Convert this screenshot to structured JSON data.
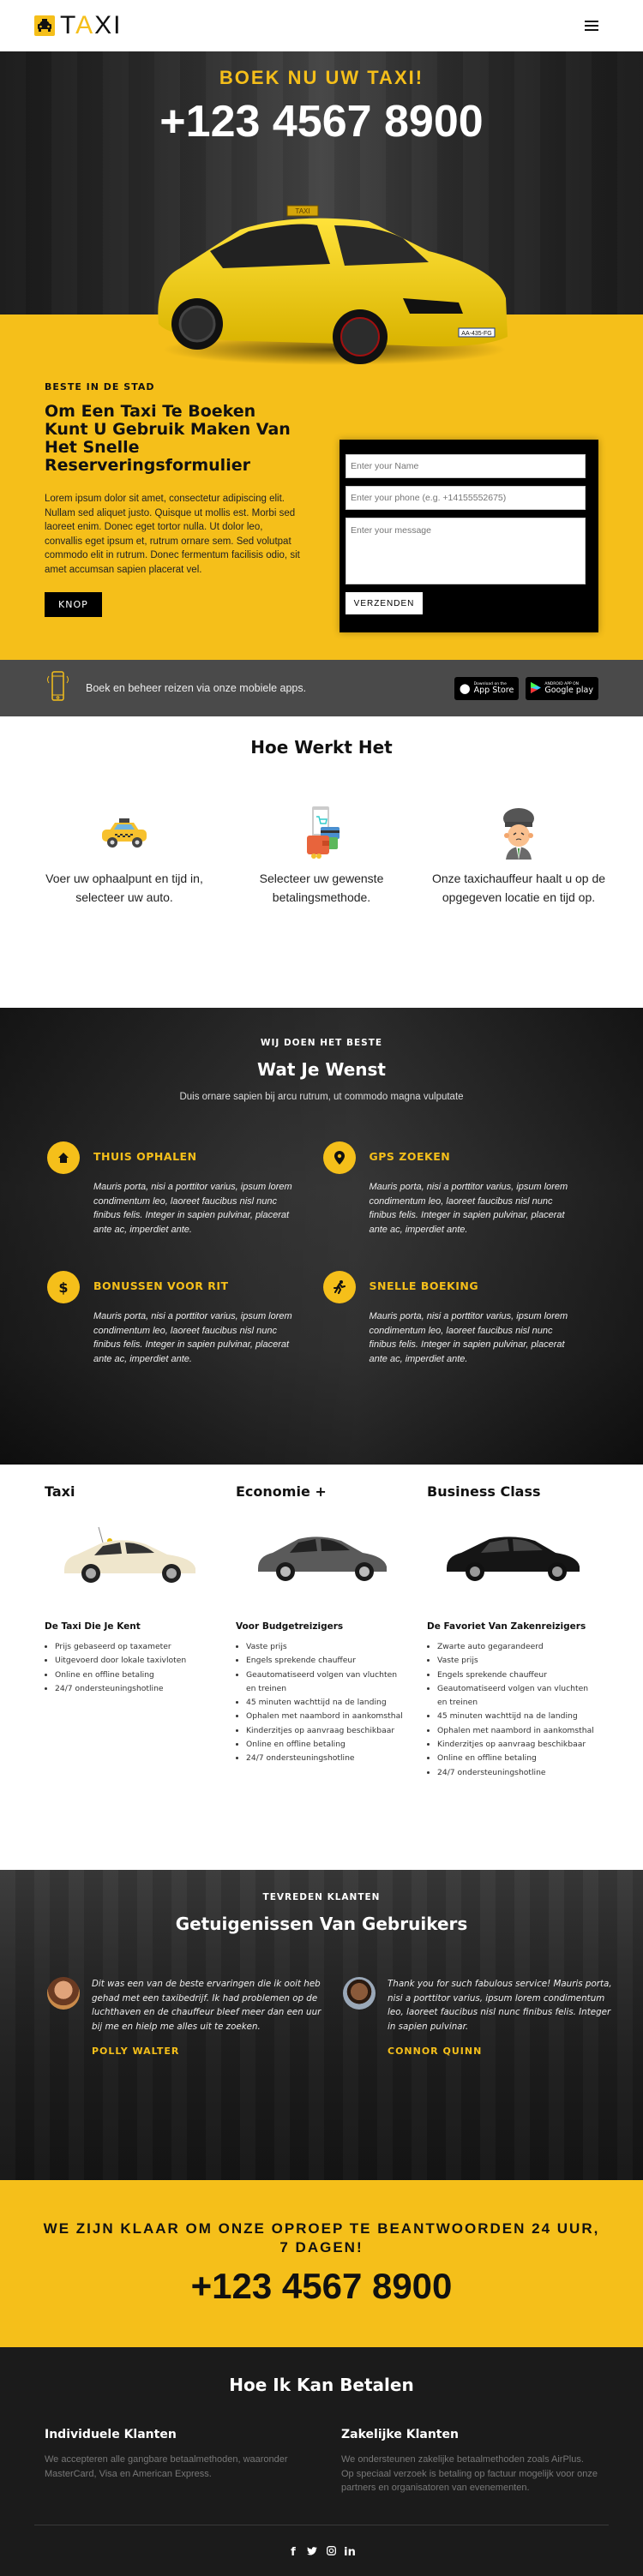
{
  "header": {
    "logo_text_pre": "T",
    "logo_text_accent": "A",
    "logo_text_post": "XI",
    "menu_icon": "hamburger-icon"
  },
  "hero": {
    "kicker": "BOEK NU UW TAXI!",
    "phone": "+123 4567 8900",
    "taxi_sign": "TAXI",
    "plate": "AA-435-FG"
  },
  "booking": {
    "kicker": "BESTE IN DE STAD",
    "title": "Om Een Taxi Te Boeken Kunt U Gebruik Maken Van Het Snelle Reserveringsformulier",
    "text": "Lorem ipsum dolor sit amet, consectetur adipiscing elit. Nullam sed aliquet justo. Quisque ut mollis est. Morbi sed laoreet enim. Donec eget tortor nulla. Ut dolor leo, convallis eget ipsum et, rutrum ornare sem. Sed volutpat commodo elit in rutrum. Donec fermentum facilisis odio, sit amet accumsan sapien placerat vel.",
    "button": "KNOP",
    "form": {
      "name_placeholder": "Enter your Name",
      "name_value": "",
      "phone_placeholder": "Enter your phone (e.g. +14155552675)",
      "phone_value": "",
      "message_placeholder": "Enter your message",
      "message_value": "",
      "submit": "VERZENDEN"
    }
  },
  "apps": {
    "text": "Boek en beheer reizen via onze mobiele apps.",
    "appstore_small": "Download on the",
    "appstore_big": "App Store",
    "googleplay_small": "ANDROID APP ON",
    "googleplay_big": "Google play"
  },
  "how": {
    "title": "Hoe Werkt Het",
    "steps": [
      {
        "icon": "taxi-icon",
        "text": "Voer uw ophaalpunt en tijd in, selecteer uw auto."
      },
      {
        "icon": "payment-icon",
        "text": "Selecteer uw gewenste betalingsmethode."
      },
      {
        "icon": "driver-icon",
        "text": "Onze taxichauffeur haalt u op de opgegeven locatie en tijd op."
      }
    ]
  },
  "services": {
    "kicker": "WIJ DOEN HET BESTE",
    "title": "Wat Je Wenst",
    "subtitle": "Duis ornare sapien bij arcu rutrum, ut commodo magna vulputate",
    "features": [
      {
        "icon": "home-icon",
        "glyph": "⌂",
        "title": "THUIS OPHALEN",
        "text": "Mauris porta, nisi a porttitor varius, ipsum lorem condimentum leo, laoreet faucibus nisl nunc finibus felis. Integer in sapien pulvinar, placerat ante ac, imperdiet ante."
      },
      {
        "icon": "map-pin-icon",
        "glyph": "●",
        "title": "GPS ZOEKEN",
        "text": "Mauris porta, nisi a porttitor varius, ipsum lorem condimentum leo, laoreet faucibus nisl nunc finibus felis. Integer in sapien pulvinar, placerat ante ac, imperdiet ante."
      },
      {
        "icon": "dollar-icon",
        "glyph": "$",
        "title": "BONUSSEN VOOR RIT",
        "text": "Mauris porta, nisi a porttitor varius, ipsum lorem condimentum leo, laoreet faucibus nisl nunc finibus felis. Integer in sapien pulvinar, placerat ante ac, imperdiet ante."
      },
      {
        "icon": "running-icon",
        "glyph": "🏃",
        "title": "SNELLE BOEKING",
        "text": "Mauris porta, nisi a porttitor varius, ipsum lorem condimentum leo, laoreet faucibus nisl nunc finibus felis. Integer in sapien pulvinar, placerat ante ac, imperdiet ante."
      }
    ]
  },
  "cars": [
    {
      "title": "Taxi",
      "subtitle": "De Taxi Die Je Kent",
      "color": "#efe6cc",
      "items": [
        "Prijs gebaseerd op taxameter",
        "Uitgevoerd door lokale taxivloten",
        "Online en offline betaling",
        "24/7 ondersteuningshotline"
      ]
    },
    {
      "title": "Economie +",
      "subtitle": "Voor Budgetreizigers",
      "color": "#5a5a5a",
      "items": [
        "Vaste prijs",
        "Engels sprekende chauffeur",
        "Geautomatiseerd volgen van vluchten en treinen",
        "45 minuten wachttijd na de landing",
        "Ophalen met naambord in aankomsthal",
        "Kinderzitjes op aanvraag beschikbaar",
        "Online en offline betaling",
        "24/7 ondersteuningshotline"
      ]
    },
    {
      "title": "Business Class",
      "subtitle": "De Favoriet Van Zakenreizigers",
      "color": "#151515",
      "items": [
        "Zwarte auto gegarandeerd",
        "Vaste prijs",
        "Engels sprekende chauffeur",
        "Geautomatiseerd volgen van vluchten en treinen",
        "45 minuten wachttijd na de landing",
        "Ophalen met naambord in aankomsthal",
        "Kinderzitjes op aanvraag beschikbaar",
        "Online en offline betaling",
        "24/7 ondersteuningshotline"
      ]
    }
  ],
  "testimonials": {
    "kicker": "TEVREDEN KLANTEN",
    "title": "Getuigenissen Van Gebruikers",
    "items": [
      {
        "text": "Dit was een van de beste ervaringen die ik ooit heb gehad met een taxibedrijf. Ik had problemen op de luchthaven en de chauffeur bleef meer dan een uur bij me en hielp me alles uit te zoeken.",
        "name": "POLLY WALTER"
      },
      {
        "text": "Thank you for such fabulous service! Mauris porta, nisi a porttitor varius, ipsum lorem condimentum leo, laoreet faucibus nisl nunc finibus felis. Integer in sapien pulvinar.",
        "name": "CONNOR QUINN"
      }
    ]
  },
  "cta": {
    "text": "WE ZIJN KLAAR OM ONZE OPROEP TE BEANTWOORDEN 24 UUR, 7 DAGEN!",
    "phone": "+123 4567 8900"
  },
  "footer": {
    "title": "Hoe Ik Kan Betalen",
    "cols": [
      {
        "title": "Individuele Klanten",
        "text": "We accepteren alle gangbare betaalmethoden, waaronder MasterCard, Visa en American Express."
      },
      {
        "title": "Zakelijke Klanten",
        "text": "We ondersteunen zakelijke betaalmethoden zoals AirPlus. Op speciaal verzoek is betaling op factuur mogelijk voor onze partners en organisatoren van evenementen."
      }
    ],
    "social": [
      {
        "name": "facebook-icon",
        "glyph": "f"
      },
      {
        "name": "twitter-icon",
        "glyph": "t"
      },
      {
        "name": "instagram-icon",
        "glyph": "◎"
      },
      {
        "name": "linkedin-icon",
        "glyph": "in"
      }
    ]
  },
  "colors": {
    "accent": "#f5bf1a",
    "dark": "#1b1b1b",
    "appbar": "#4a4a4a"
  }
}
